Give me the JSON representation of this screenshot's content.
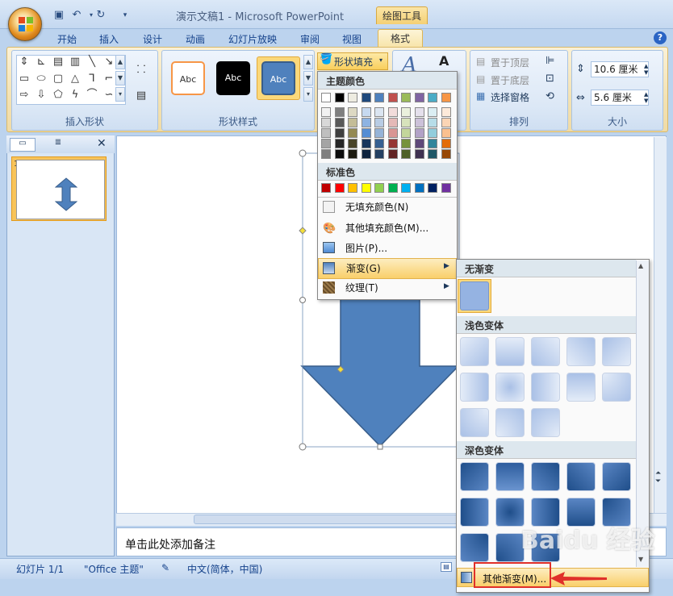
{
  "window": {
    "title": "演示文稿1 - Microsoft PowerPoint",
    "context_tab_group": "绘图工具"
  },
  "ribbon": {
    "tabs": [
      "开始",
      "插入",
      "设计",
      "动画",
      "幻灯片放映",
      "审阅",
      "视图"
    ],
    "active_tab": "格式",
    "groups": {
      "insert_shapes": "插入形状",
      "shape_styles": "形状样式",
      "arrange": "排列",
      "size": "大小"
    },
    "style_samples": [
      "Abc",
      "Abc",
      "Abc"
    ],
    "shape_fill_label": "形状填充",
    "arrange": {
      "bring_front": "置于顶层",
      "send_back": "置于底层",
      "selection_pane": "选择窗格"
    },
    "size": {
      "height": "10.6 厘米",
      "width": "5.6 厘米"
    }
  },
  "fill_menu": {
    "theme_colors_header": "主题颜色",
    "standard_colors_header": "标准色",
    "theme_top_row": [
      "#ffffff",
      "#000000",
      "#eeece1",
      "#1f497d",
      "#4f81bd",
      "#c0504d",
      "#9bbb59",
      "#8064a2",
      "#4bacc6",
      "#f79646"
    ],
    "theme_shades": [
      [
        "#f2f2f2",
        "#7f7f7f",
        "#ddd9c3",
        "#c6d9f0",
        "#dbe5f1",
        "#f2dcdb",
        "#ebf1dd",
        "#e5e0ec",
        "#dbeef3",
        "#fdeada"
      ],
      [
        "#d8d8d8",
        "#595959",
        "#c4bd97",
        "#8db3e2",
        "#b8cce4",
        "#e5b9b7",
        "#d7e3bc",
        "#ccc1d9",
        "#b7dde8",
        "#fbd5b5"
      ],
      [
        "#bfbfbf",
        "#3f3f3f",
        "#938953",
        "#548dd4",
        "#95b3d7",
        "#d99694",
        "#c3d69b",
        "#b2a2c7",
        "#92cddc",
        "#fac08f"
      ],
      [
        "#a5a5a5",
        "#262626",
        "#494429",
        "#17365d",
        "#366092",
        "#953734",
        "#76923c",
        "#5f497a",
        "#31859b",
        "#e36c09"
      ],
      [
        "#7f7f7f",
        "#0c0c0c",
        "#1d1b10",
        "#0f243e",
        "#244061",
        "#632423",
        "#4f6128",
        "#3f3151",
        "#205867",
        "#974806"
      ]
    ],
    "standard": [
      "#c00000",
      "#ff0000",
      "#ffc000",
      "#ffff00",
      "#92d050",
      "#00b050",
      "#00b0f0",
      "#0070c0",
      "#002060",
      "#7030a0"
    ],
    "items": {
      "no_fill": "无填充颜色(N)",
      "more_colors": "其他填充颜色(M)...",
      "picture": "图片(P)...",
      "gradient": "渐变(G)",
      "texture": "纹理(T)"
    }
  },
  "gradient_menu": {
    "no_gradient": "无渐变",
    "light_variations": "浅色变体",
    "dark_variations": "深色变体",
    "more_gradients": "其他渐变(M)..."
  },
  "notes_placeholder": "单击此处添加备注",
  "status": {
    "slide": "幻灯片 1/1",
    "theme": "\"Office 主题\"",
    "language": "中文(简体，中国)"
  },
  "slide_number": "1",
  "watermark": "Baidu 经验"
}
